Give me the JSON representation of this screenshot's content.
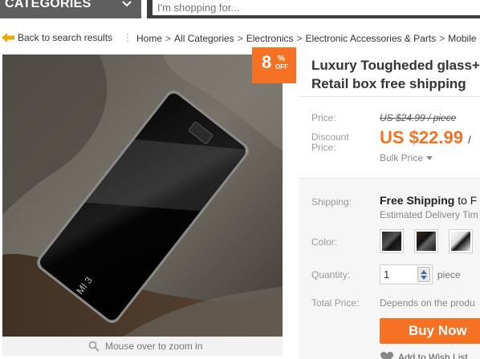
{
  "header": {
    "categories_label": "CATEGORIES",
    "search_placeholder": "I'm shopping for..."
  },
  "breadcrumb": {
    "back_label": "Back to search results",
    "items": [
      "Home",
      "All Categories",
      "Electronics",
      "Electronic Accessories & Parts",
      "Mobile"
    ]
  },
  "product": {
    "title_line1": "Luxury Tougheded glass+a",
    "title_line2": "Retail box free shipping",
    "discount_badge": {
      "number": "8",
      "percent": "%",
      "off": "OFF"
    },
    "zoom_hint": "Mouse over to zoom in",
    "phone_logo": "MI 3"
  },
  "pricing": {
    "price_label": "Price:",
    "original_price": "US $24.99 / piece",
    "discount_label": "Discount Price:",
    "discount_price": "US $22.99",
    "discount_unit": "/",
    "bulk_price_label": "Bulk Price"
  },
  "options": {
    "shipping_label": "Shipping:",
    "shipping_value_bold": "Free Shipping",
    "shipping_value_rest": " to F",
    "delivery_estimate": "Estimated Delivery Tim",
    "color_label": "Color:",
    "quantity_label": "Quantity:",
    "quantity_value": "1",
    "quantity_unit": "piece",
    "total_label": "Total Price:",
    "total_value": "Depends on the produ",
    "buy_now_label": "Buy Now",
    "wishlist_label": "Add to Wish List"
  },
  "colors": {
    "accent": "#f57224",
    "header_gray": "#5f5f5f",
    "search_frame": "#3d3d3d"
  }
}
